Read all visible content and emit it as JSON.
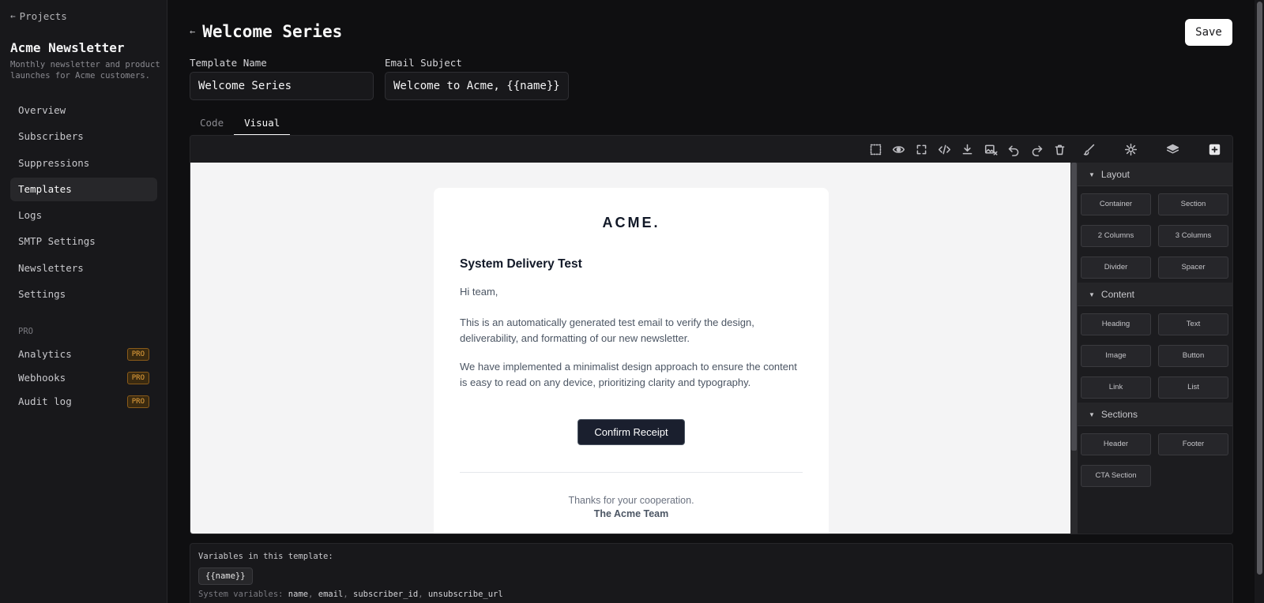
{
  "sidebar": {
    "back_label": "Projects",
    "project_title": "Acme Newsletter",
    "project_desc": "Monthly newsletter and product launches for Acme customers.",
    "items": [
      {
        "label": "Overview"
      },
      {
        "label": "Subscribers"
      },
      {
        "label": "Suppressions"
      },
      {
        "label": "Templates",
        "active": true
      },
      {
        "label": "Logs"
      },
      {
        "label": "SMTP Settings"
      },
      {
        "label": "Newsletters"
      },
      {
        "label": "Settings"
      }
    ],
    "pro_section_label": "PRO",
    "pro_items": [
      {
        "label": "Analytics",
        "badge": "PRO"
      },
      {
        "label": "Webhooks",
        "badge": "PRO"
      },
      {
        "label": "Audit log",
        "badge": "PRO"
      }
    ]
  },
  "header": {
    "title": "Welcome Series",
    "save_label": "Save"
  },
  "form": {
    "template_name_label": "Template Name",
    "template_name_value": "Welcome Series",
    "email_subject_label": "Email Subject",
    "email_subject_value": "Welcome to Acme, {{name}}"
  },
  "tabs": [
    {
      "label": "Code"
    },
    {
      "label": "Visual",
      "active": true
    }
  ],
  "toolbar_icons": [
    "select-outline-icon",
    "eye-icon",
    "fullscreen-icon",
    "code-icon",
    "download-icon",
    "image-remove-icon",
    "undo-icon",
    "redo-icon",
    "trash-icon",
    "brush-icon",
    "gear-icon",
    "layers-icon",
    "add-block-icon"
  ],
  "email": {
    "logo": "ACME.",
    "heading": "System Delivery Test",
    "greeting": "Hi team,",
    "para1": "This is an automatically generated test email to verify the design, deliverability, and formatting of our new newsletter.",
    "para2": "We have implemented a minimalist design approach to ensure the content is easy to read on any device, prioritizing clarity and typography.",
    "cta_label": "Confirm Receipt",
    "footer_line1": "Thanks for your cooperation.",
    "footer_line2": "The Acme Team"
  },
  "blocks_panel": {
    "sections": [
      {
        "title": "Layout",
        "blocks": [
          "Container",
          "Section",
          "2 Columns",
          "3 Columns",
          "Divider",
          "Spacer"
        ]
      },
      {
        "title": "Content",
        "blocks": [
          "Heading",
          "Text",
          "Image",
          "Button",
          "Link",
          "List"
        ]
      },
      {
        "title": "Sections",
        "blocks": [
          "Header",
          "Footer",
          "CTA Section"
        ]
      }
    ]
  },
  "variables": {
    "label": "Variables in this template:",
    "template_vars": [
      "{{name}}"
    ],
    "system_label": "System variables:",
    "system_vars": [
      "name",
      "email",
      "subscriber_id",
      "unsubscribe_url"
    ]
  },
  "colors": {
    "background": "#0f0f11",
    "sidebar": "#18181b",
    "accent_badge": "#e8a33d",
    "cta": "#1a1f2e"
  }
}
